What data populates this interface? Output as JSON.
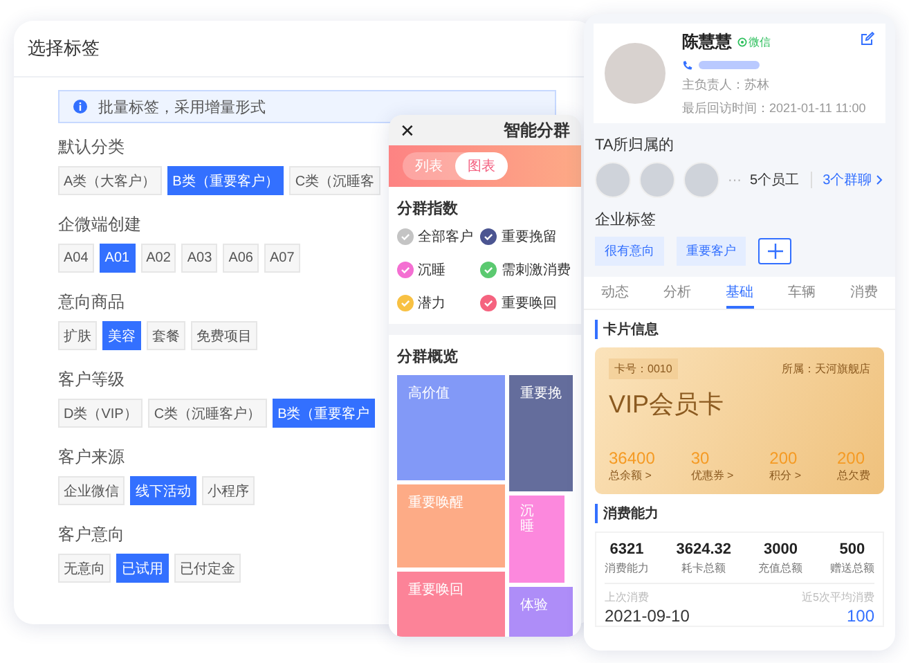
{
  "tag_panel": {
    "title": "选择标签",
    "notice": "批量标签，采用增量形式",
    "groups": [
      {
        "label": "默认分类",
        "tags": [
          {
            "text": "A类（大客户）",
            "selected": false
          },
          {
            "text": "B类（重要客户）",
            "selected": true
          },
          {
            "text": "C类（沉睡客",
            "selected": false
          }
        ]
      },
      {
        "label": "企微端创建",
        "tags": [
          {
            "text": "A04",
            "selected": false
          },
          {
            "text": "A01",
            "selected": true
          },
          {
            "text": "A02",
            "selected": false
          },
          {
            "text": "A03",
            "selected": false
          },
          {
            "text": "A06",
            "selected": false
          },
          {
            "text": "A07",
            "selected": false
          }
        ]
      },
      {
        "label": "意向商品",
        "tags": [
          {
            "text": "扩肤",
            "selected": false
          },
          {
            "text": "美容",
            "selected": true
          },
          {
            "text": "套餐",
            "selected": false
          },
          {
            "text": "免费项目",
            "selected": false
          }
        ]
      },
      {
        "label": "客户等级",
        "tags": [
          {
            "text": "D类（VIP）",
            "selected": false
          },
          {
            "text": "C类（沉睡客户）",
            "selected": false
          },
          {
            "text": "B类（重要客户",
            "selected": true
          }
        ]
      },
      {
        "label": "客户来源",
        "tags": [
          {
            "text": "企业微信",
            "selected": false
          },
          {
            "text": "线下活动",
            "selected": true
          },
          {
            "text": "小程序",
            "selected": false
          }
        ]
      },
      {
        "label": "客户意向",
        "tags": [
          {
            "text": "无意向",
            "selected": false
          },
          {
            "text": "已试用",
            "selected": true
          },
          {
            "text": "已付定金",
            "selected": false
          }
        ]
      }
    ]
  },
  "segment_panel": {
    "close": "✕",
    "title": "智能分群",
    "view_toggle": [
      {
        "label": "列表",
        "selected": false
      },
      {
        "label": "图表",
        "selected": true
      }
    ],
    "index_title": "分群指数",
    "legend": [
      {
        "label": "全部客户",
        "color": "#c4c4c4"
      },
      {
        "label": "重要挽留",
        "color": "#4b5591"
      },
      {
        "label": "沉睡",
        "color": "#f46fd2"
      },
      {
        "label": "需刺激消费",
        "color": "#5bc970"
      },
      {
        "label": "潜力",
        "color": "#f8c143"
      },
      {
        "label": "重要唤回",
        "color": "#f5637f"
      }
    ],
    "overview_title": "分群概览",
    "treemap": [
      {
        "label": "高价值",
        "color": "#8299f7"
      },
      {
        "label": "重要挽",
        "color": "#646d9c"
      },
      {
        "label": "重要唤醒",
        "color": "#fdab86"
      },
      {
        "label": "沉睡",
        "color": "#fc88dd"
      },
      {
        "label": "重要唤回",
        "color": "#fc8398"
      },
      {
        "label": "体验",
        "color": "#ae8df8"
      }
    ]
  },
  "customer_panel": {
    "name": "陈慧慧",
    "channel": "微信",
    "owner": "主负责人：苏林",
    "last_visit": "最后回访时间：2021-01-11 11:00",
    "belongs_title": "TA所归属的",
    "more": "···",
    "staff_count": "5个员工",
    "group_count": "3个群聊",
    "tags_title": "企业标签",
    "tags": [
      "很有意向",
      "重要客户"
    ],
    "tabs": [
      {
        "label": "动态",
        "selected": false
      },
      {
        "label": "分析",
        "selected": false
      },
      {
        "label": "基础",
        "selected": true
      },
      {
        "label": "车辆",
        "selected": false
      },
      {
        "label": "消费",
        "selected": false
      }
    ],
    "card_title": "卡片信息",
    "card": {
      "number": "卡号：0010",
      "store": "所属：天河旗舰店",
      "name": "VIP会员卡",
      "stats": [
        {
          "value": "36400",
          "label": "总余额 >"
        },
        {
          "value": "30",
          "label": "优惠券 >"
        },
        {
          "value": "200",
          "label": "积分 >"
        },
        {
          "value": "200",
          "label": "总欠费"
        }
      ]
    },
    "spend_title": "消费能力",
    "spend_stats": [
      {
        "value": "6321",
        "label": "消费能力"
      },
      {
        "value": "3624.32",
        "label": "耗卡总额"
      },
      {
        "value": "3000",
        "label": "充值总额"
      },
      {
        "value": "500",
        "label": "赠送总额"
      }
    ],
    "last_label": "上次消费",
    "last_value": "2021-09-10",
    "avg_label": "近5次平均消费",
    "avg_value": "100"
  }
}
